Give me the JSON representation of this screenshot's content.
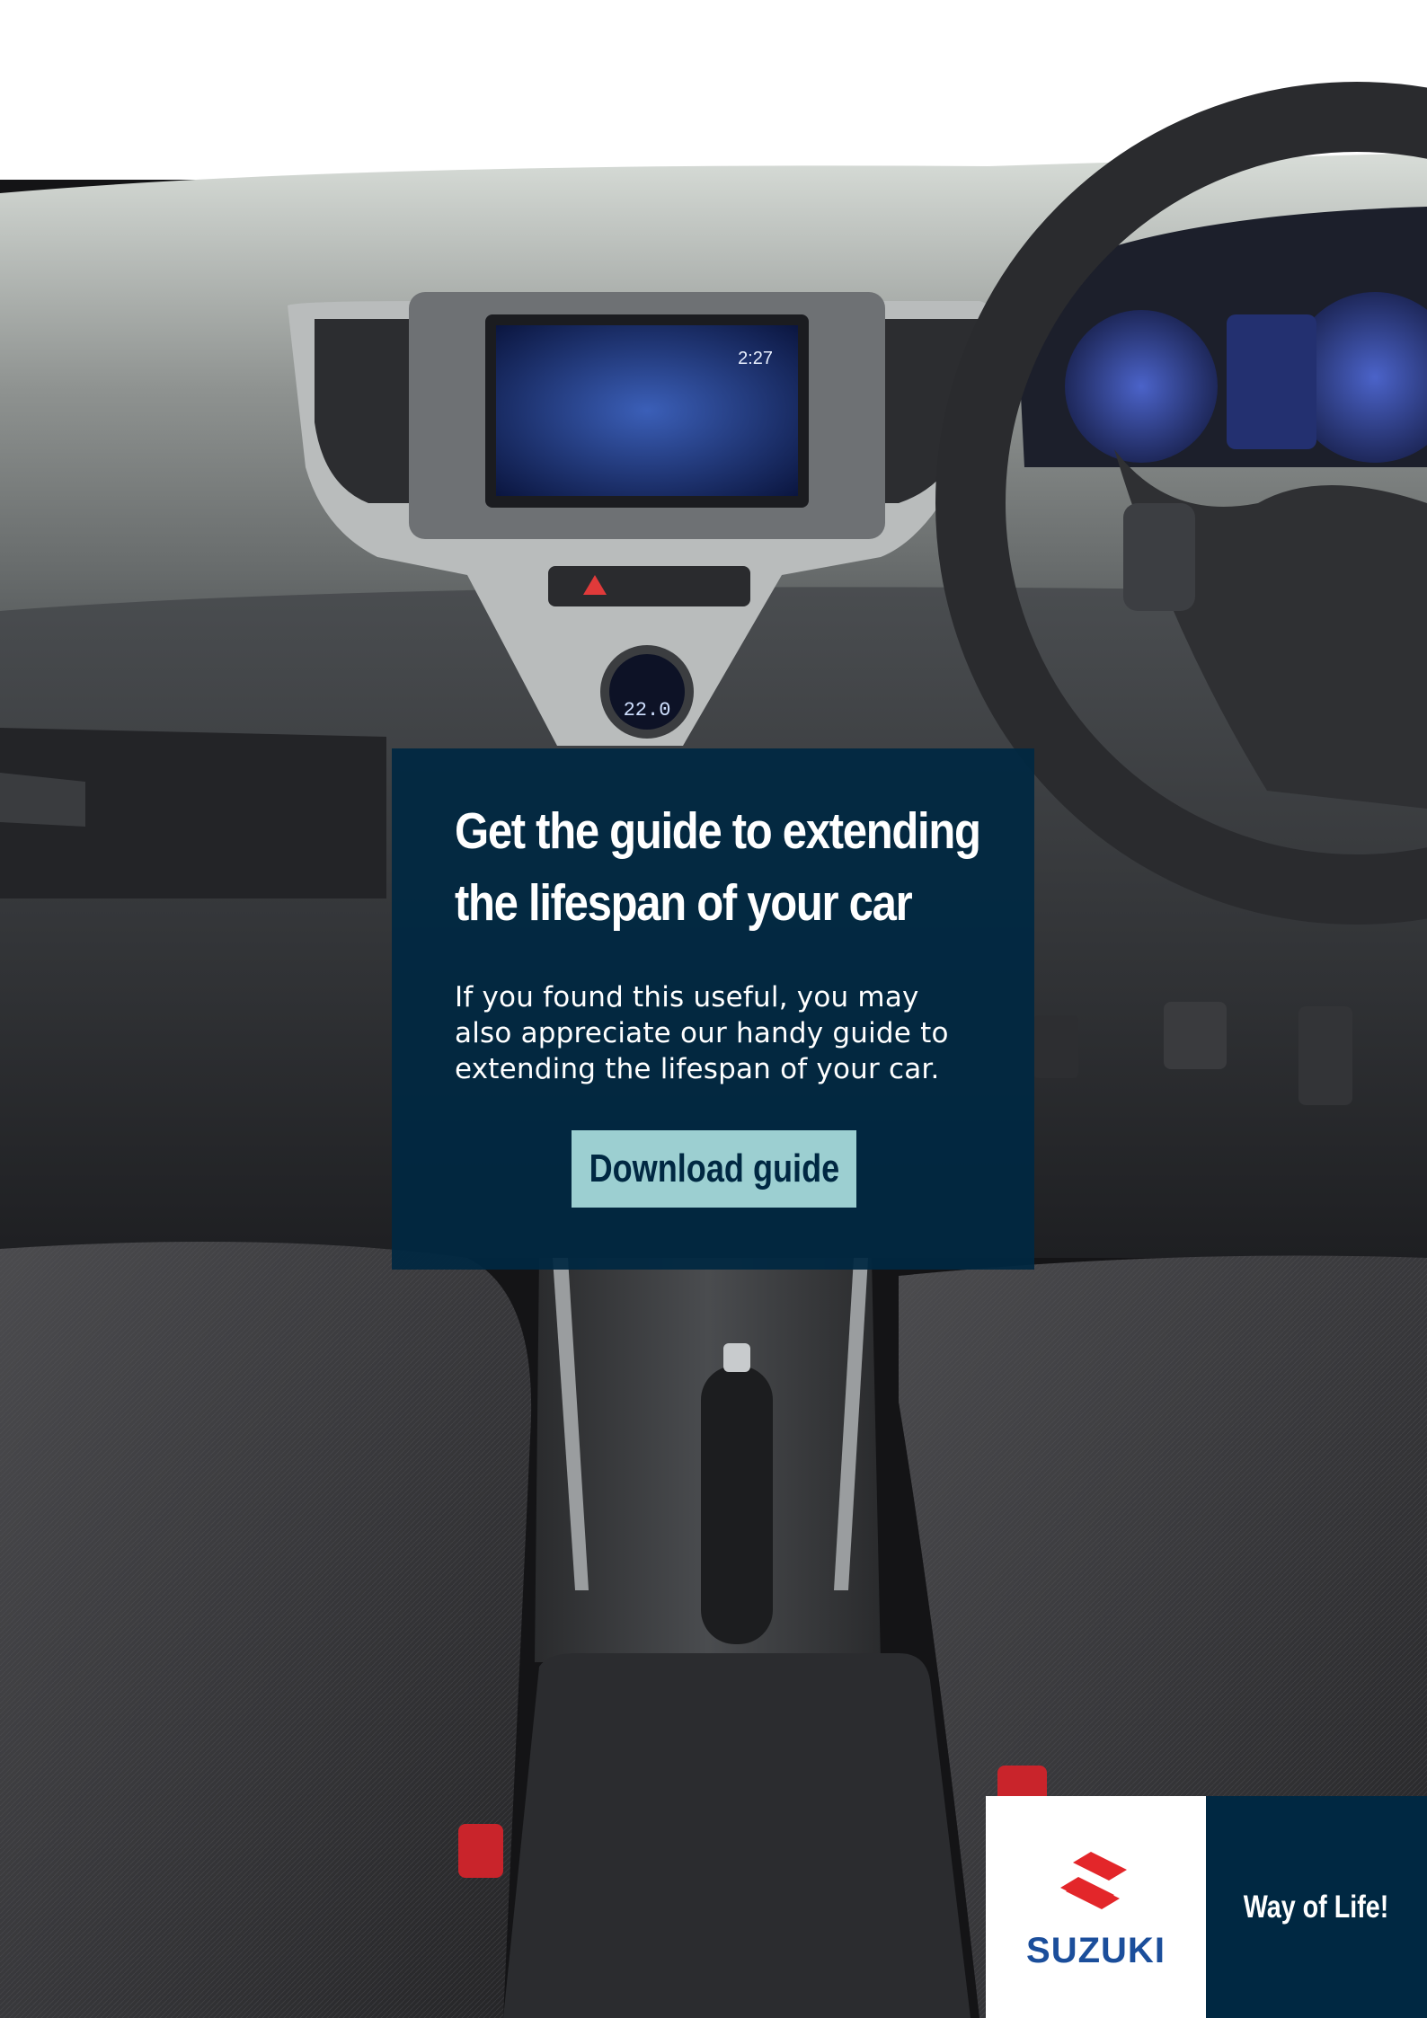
{
  "cta": {
    "headline": "Get the guide to extending the lifespan of your car",
    "body": "If you found this useful, you may also appreciate our handy guide to extending the lifespan of your car.",
    "button_label": "Download guide"
  },
  "brand": {
    "name": "SUZUKI",
    "tagline": "Way of Life!",
    "logo_icon": "suzuki-s-logo-icon"
  },
  "dashboard": {
    "screen_time": "2:27",
    "climate_temp": "22.0"
  },
  "colors": {
    "panel": "#002842",
    "button": "#9ccfd1",
    "brand_red": "#e3262a",
    "brand_blue": "#1b4e9b"
  }
}
